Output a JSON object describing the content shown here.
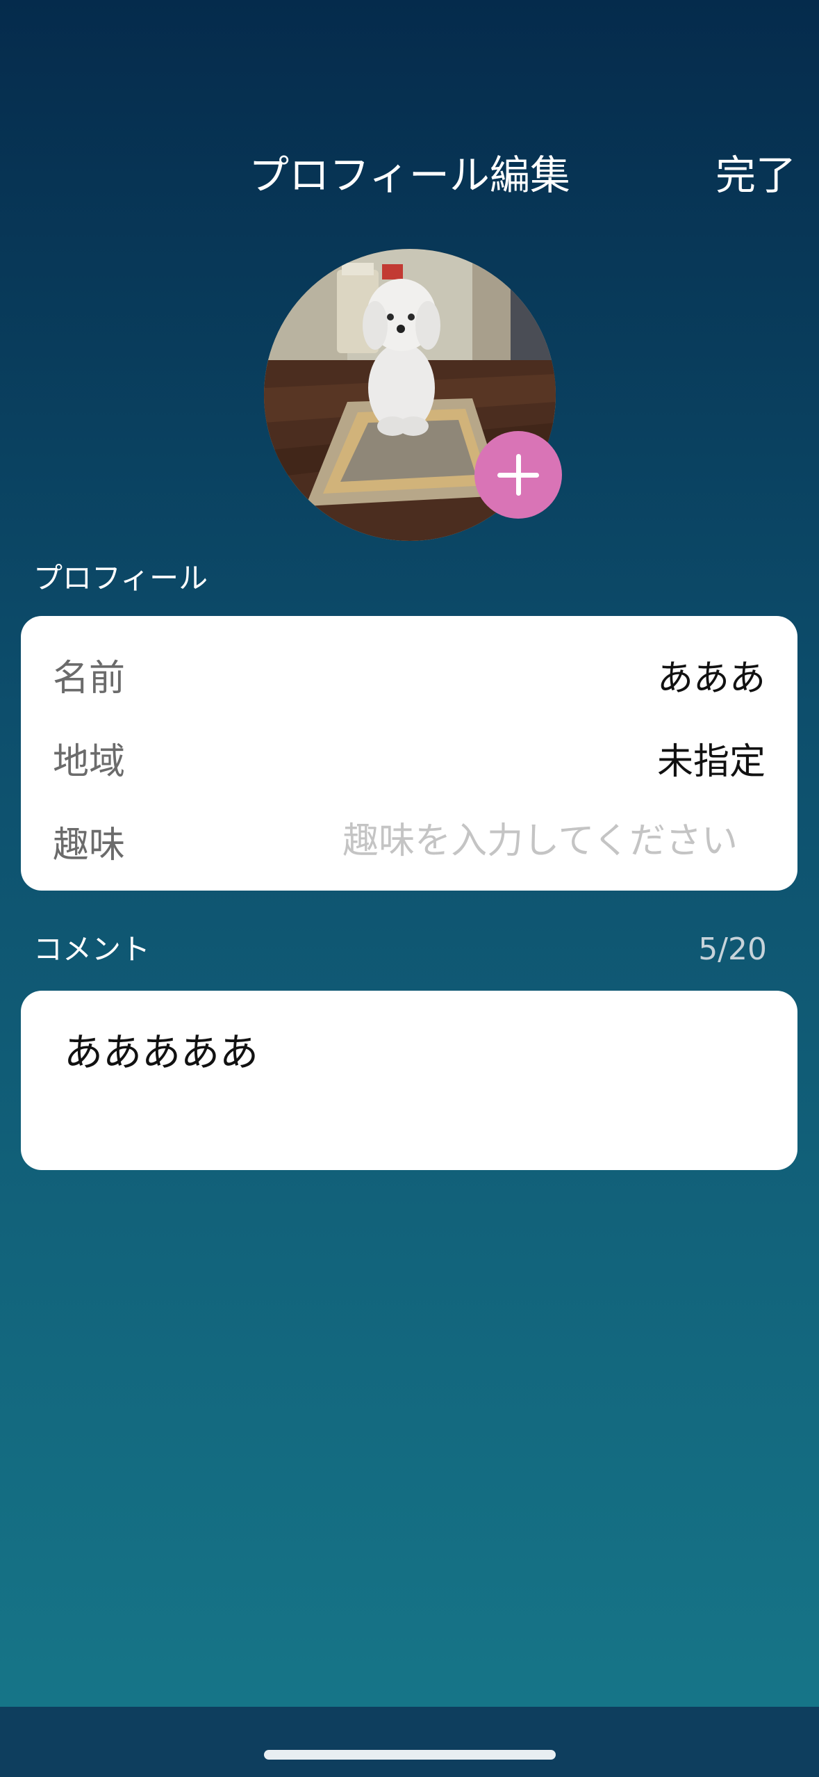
{
  "header": {
    "title": "プロフィール編集",
    "done_label": "完了"
  },
  "avatar": {
    "description_icon": "dog-photo",
    "add_icon": "plus-icon",
    "add_button_color": "#d974b6"
  },
  "profile_section": {
    "label": "プロフィール",
    "rows": [
      {
        "label": "名前",
        "value": "あああ"
      },
      {
        "label": "地域",
        "value": "未指定"
      },
      {
        "label": "趣味",
        "value": "",
        "placeholder": "趣味を入力してください"
      }
    ]
  },
  "comment_section": {
    "label": "コメント",
    "counter": "5/20",
    "text": "あああああ"
  },
  "colors": {
    "background_top": "#052b4c",
    "background_bottom": "#17788a",
    "card": "#ffffff",
    "accent": "#d974b6"
  }
}
